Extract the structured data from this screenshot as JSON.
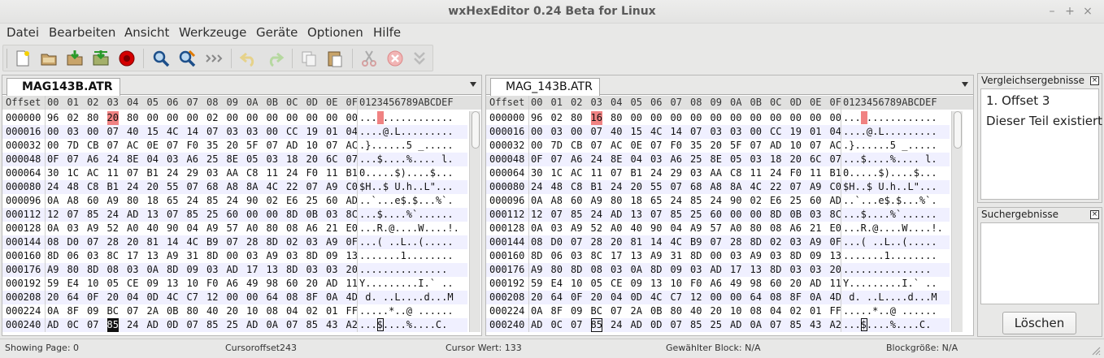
{
  "window": {
    "title": "wxHexEditor 0.24 Beta for Linux"
  },
  "menu": [
    "Datei",
    "Bearbeiten",
    "Ansicht",
    "Werkzeuge",
    "Geräte",
    "Optionen",
    "Hilfe"
  ],
  "toolbar": {
    "icons": [
      "new-file-icon",
      "open-file-icon",
      "save-file-icon",
      "save-as-icon",
      "close-red-icon",
      "find-icon",
      "replace-icon",
      "goto-icon",
      "undo-icon",
      "redo-icon",
      "copy-icon",
      "paste-icon",
      "cut-icon",
      "delete-icon",
      "insert-icon"
    ]
  },
  "header": {
    "offset_label": "Offset",
    "columns": [
      "00",
      "01",
      "02",
      "03",
      "04",
      "05",
      "06",
      "07",
      "08",
      "09",
      "0A",
      "0B",
      "0C",
      "0D",
      "0E",
      "0F"
    ],
    "text_label": "0123456789ABCDEF"
  },
  "left": {
    "tab": "MAG143B.ATR",
    "rows": [
      {
        "o": "000000",
        "h": [
          "96",
          "02",
          "80",
          "20",
          "80",
          "00",
          "00",
          "00",
          "02",
          "00",
          "00",
          "00",
          "00",
          "00",
          "00",
          "00"
        ],
        "t": "... ............"
      },
      {
        "o": "000016",
        "h": [
          "00",
          "03",
          "00",
          "07",
          "40",
          "15",
          "4C",
          "14",
          "07",
          "03",
          "03",
          "00",
          "CC",
          "19",
          "01",
          "04"
        ],
        "t": "....@.L........."
      },
      {
        "o": "000032",
        "h": [
          "00",
          "7D",
          "CB",
          "07",
          "AC",
          "0E",
          "07",
          "F0",
          "35",
          "20",
          "5F",
          "07",
          "AD",
          "10",
          "07",
          "AC"
        ],
        "t": ".}......5 _....."
      },
      {
        "o": "000048",
        "h": [
          "0F",
          "07",
          "A6",
          "24",
          "8E",
          "04",
          "03",
          "A6",
          "25",
          "8E",
          "05",
          "03",
          "18",
          "20",
          "6C",
          "07"
        ],
        "t": "...$....%.... l."
      },
      {
        "o": "000064",
        "h": [
          "30",
          "1C",
          "AC",
          "11",
          "07",
          "B1",
          "24",
          "29",
          "03",
          "AA",
          "C8",
          "11",
          "24",
          "F0",
          "11",
          "B1"
        ],
        "t": "0.....$)....$..."
      },
      {
        "o": "000080",
        "h": [
          "24",
          "48",
          "C8",
          "B1",
          "24",
          "20",
          "55",
          "07",
          "68",
          "A8",
          "8A",
          "4C",
          "22",
          "07",
          "A9",
          "C0"
        ],
        "t": "$H..$ U.h..L\"..."
      },
      {
        "o": "000096",
        "h": [
          "0A",
          "A8",
          "60",
          "A9",
          "80",
          "18",
          "65",
          "24",
          "85",
          "24",
          "90",
          "02",
          "E6",
          "25",
          "60",
          "AD"
        ],
        "t": "..`...e$.$...%`."
      },
      {
        "o": "000112",
        "h": [
          "12",
          "07",
          "85",
          "24",
          "AD",
          "13",
          "07",
          "85",
          "25",
          "60",
          "00",
          "00",
          "8D",
          "0B",
          "03",
          "8C"
        ],
        "t": "...$....%`......"
      },
      {
        "o": "000128",
        "h": [
          "0A",
          "03",
          "A9",
          "52",
          "A0",
          "40",
          "90",
          "04",
          "A9",
          "57",
          "A0",
          "80",
          "08",
          "A6",
          "21",
          "E0"
        ],
        "t": "...R.@....W....!."
      },
      {
        "o": "000144",
        "h": [
          "08",
          "D0",
          "07",
          "28",
          "20",
          "81",
          "14",
          "4C",
          "B9",
          "07",
          "28",
          "8D",
          "02",
          "03",
          "A9",
          "0F"
        ],
        "t": "...( ..L..(....."
      },
      {
        "o": "000160",
        "h": [
          "8D",
          "06",
          "03",
          "8C",
          "17",
          "13",
          "A9",
          "31",
          "8D",
          "00",
          "03",
          "A9",
          "03",
          "8D",
          "09",
          "13"
        ],
        "t": ".......1........"
      },
      {
        "o": "000176",
        "h": [
          "A9",
          "80",
          "8D",
          "08",
          "03",
          "0A",
          "8D",
          "09",
          "03",
          "AD",
          "17",
          "13",
          "8D",
          "03",
          "03",
          "20"
        ],
        "t": "............... "
      },
      {
        "o": "000192",
        "h": [
          "59",
          "E4",
          "10",
          "05",
          "CE",
          "09",
          "13",
          "10",
          "F0",
          "A6",
          "49",
          "98",
          "60",
          "20",
          "AD",
          "11"
        ],
        "t": "Y.........I.` .."
      },
      {
        "o": "000208",
        "h": [
          "20",
          "64",
          "0F",
          "20",
          "04",
          "0D",
          "4C",
          "C7",
          "12",
          "00",
          "00",
          "64",
          "08",
          "8F",
          "0A",
          "4D"
        ],
        "t": " d. ..L....d...M"
      },
      {
        "o": "000224",
        "h": [
          "0A",
          "8F",
          "09",
          "BC",
          "07",
          "2A",
          "0B",
          "80",
          "40",
          "20",
          "10",
          "08",
          "04",
          "02",
          "01",
          "FF"
        ],
        "t": ".....*..@ ......"
      },
      {
        "o": "000240",
        "h": [
          "AD",
          "0C",
          "07",
          "85",
          "24",
          "AD",
          "0D",
          "07",
          "85",
          "25",
          "AD",
          "0A",
          "07",
          "85",
          "43",
          "A2"
        ],
        "t": "...$....%....C."
      }
    ]
  },
  "right": {
    "tab": "MAG_143B.ATR",
    "rows": [
      {
        "o": "000000",
        "h": [
          "96",
          "02",
          "80",
          "16",
          "80",
          "00",
          "00",
          "00",
          "00",
          "00",
          "00",
          "00",
          "00",
          "00",
          "00",
          "00"
        ],
        "t": "... ............"
      },
      {
        "o": "000016",
        "h": [
          "00",
          "03",
          "00",
          "07",
          "40",
          "15",
          "4C",
          "14",
          "07",
          "03",
          "03",
          "00",
          "CC",
          "19",
          "01",
          "04"
        ],
        "t": "....@.L........."
      },
      {
        "o": "000032",
        "h": [
          "00",
          "7D",
          "CB",
          "07",
          "AC",
          "0E",
          "07",
          "F0",
          "35",
          "20",
          "5F",
          "07",
          "AD",
          "10",
          "07",
          "AC"
        ],
        "t": ".}......5 _....."
      },
      {
        "o": "000048",
        "h": [
          "0F",
          "07",
          "A6",
          "24",
          "8E",
          "04",
          "03",
          "A6",
          "25",
          "8E",
          "05",
          "03",
          "18",
          "20",
          "6C",
          "07"
        ],
        "t": "...$....%.... l."
      },
      {
        "o": "000064",
        "h": [
          "30",
          "1C",
          "AC",
          "11",
          "07",
          "B1",
          "24",
          "29",
          "03",
          "AA",
          "C8",
          "11",
          "24",
          "F0",
          "11",
          "B1"
        ],
        "t": "0.....$)....$..."
      },
      {
        "o": "000080",
        "h": [
          "24",
          "48",
          "C8",
          "B1",
          "24",
          "20",
          "55",
          "07",
          "68",
          "A8",
          "8A",
          "4C",
          "22",
          "07",
          "A9",
          "C0"
        ],
        "t": "$H..$ U.h..L\"..."
      },
      {
        "o": "000096",
        "h": [
          "0A",
          "A8",
          "60",
          "A9",
          "80",
          "18",
          "65",
          "24",
          "85",
          "24",
          "90",
          "02",
          "E6",
          "25",
          "60",
          "AD"
        ],
        "t": "..`...e$.$...%`."
      },
      {
        "o": "000112",
        "h": [
          "12",
          "07",
          "85",
          "24",
          "AD",
          "13",
          "07",
          "85",
          "25",
          "60",
          "00",
          "00",
          "8D",
          "0B",
          "03",
          "8C"
        ],
        "t": "...$....%`......"
      },
      {
        "o": "000128",
        "h": [
          "0A",
          "03",
          "A9",
          "52",
          "A0",
          "40",
          "90",
          "04",
          "A9",
          "57",
          "A0",
          "80",
          "08",
          "A6",
          "21",
          "E0"
        ],
        "t": "...R.@....W....!."
      },
      {
        "o": "000144",
        "h": [
          "08",
          "D0",
          "07",
          "28",
          "20",
          "81",
          "14",
          "4C",
          "B9",
          "07",
          "28",
          "8D",
          "02",
          "03",
          "A9",
          "0F"
        ],
        "t": "...( ..L..(....."
      },
      {
        "o": "000160",
        "h": [
          "8D",
          "06",
          "03",
          "8C",
          "17",
          "13",
          "A9",
          "31",
          "8D",
          "00",
          "03",
          "A9",
          "03",
          "8D",
          "09",
          "13"
        ],
        "t": ".......1........"
      },
      {
        "o": "000176",
        "h": [
          "A9",
          "80",
          "8D",
          "08",
          "03",
          "0A",
          "8D",
          "09",
          "03",
          "AD",
          "17",
          "13",
          "8D",
          "03",
          "03",
          "20"
        ],
        "t": "............... "
      },
      {
        "o": "000192",
        "h": [
          "59",
          "E4",
          "10",
          "05",
          "CE",
          "09",
          "13",
          "10",
          "F0",
          "A6",
          "49",
          "98",
          "60",
          "20",
          "AD",
          "11"
        ],
        "t": "Y.........I.` .."
      },
      {
        "o": "000208",
        "h": [
          "20",
          "64",
          "0F",
          "20",
          "04",
          "0D",
          "4C",
          "C7",
          "12",
          "00",
          "00",
          "64",
          "08",
          "8F",
          "0A",
          "4D"
        ],
        "t": " d. ..L....d...M"
      },
      {
        "o": "000224",
        "h": [
          "0A",
          "8F",
          "09",
          "BC",
          "07",
          "2A",
          "0B",
          "80",
          "40",
          "20",
          "10",
          "08",
          "04",
          "02",
          "01",
          "FF"
        ],
        "t": ".....*..@ ......"
      },
      {
        "o": "000240",
        "h": [
          "AD",
          "0C",
          "07",
          "85",
          "24",
          "AD",
          "0D",
          "07",
          "85",
          "25",
          "AD",
          "0A",
          "07",
          "85",
          "43",
          "A2"
        ],
        "t": "...$....%....C."
      }
    ]
  },
  "compare": {
    "title": "Vergleichsergebnisse",
    "items": [
      "1. Offset 3",
      "Dieser Teil existiert"
    ]
  },
  "search": {
    "title": "Suchergebnisse"
  },
  "clear_button": "Löschen",
  "status": {
    "page": "Showing Page: 0",
    "cursor_offset": "Cursoroffset243",
    "cursor_value": "Cursor Wert: 133",
    "block": "Gewählter Block: N/A",
    "block_size": "Blockgröße: N/A"
  },
  "colors": {
    "diff_highlight": "#f08282",
    "alt_row": "#f0f0ff"
  }
}
